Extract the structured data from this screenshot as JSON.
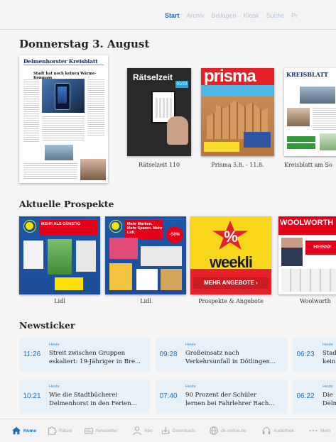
{
  "topnav": {
    "tabs": [
      "Start",
      "Archiv",
      "Beilagen",
      "Kiosk",
      "Suche",
      "Pr"
    ],
    "active": 0
  },
  "date_title": "Donnerstag 3. August",
  "issues": {
    "main_paper": {
      "masthead": "Delmenhorster Kreisblatt",
      "headline": "Stadt hat noch keinen Wärme-Kompass"
    },
    "items": [
      {
        "caption": "Rätselzeit 110",
        "cover_title": "Rätselzeit",
        "badge": "01/23"
      },
      {
        "caption": "Prisma 5.8. - 11.8.",
        "cover_title": "prisma"
      },
      {
        "caption": "Kreisblatt am So",
        "cover_title": "KREISBLATT"
      }
    ]
  },
  "prospekte": {
    "title": "Aktuelle Prospekte",
    "items": [
      {
        "caption": "Lidl",
        "banner": "MEHR ALS GÜNSTIG"
      },
      {
        "caption": "Lidl",
        "banner": "Mehr Marken. Mehr Sparen. Mehr Lidl.",
        "sale": "-50%"
      },
      {
        "caption": "Prospekte & Angebote",
        "pct": "%",
        "brand": "weekli",
        "button": "MEHR ANGEBOTE ›"
      },
      {
        "caption": "Woolworth",
        "brand": "WOOLWORTH",
        "hot": "HEISSE PREISE"
      }
    ]
  },
  "newsticker": {
    "title": "Newsticker",
    "items": [
      {
        "time": "11:26",
        "label": "Heute",
        "line1": "Streit zwischen Gruppen",
        "line2": "eskaliert: 19-Jähriger in Bre..."
      },
      {
        "time": "09:28",
        "label": "Heute",
        "line1": "Großeinsatz nach",
        "line2": "Verkehrsunfall in Dötlingen..."
      },
      {
        "time": "06:23",
        "label": "Heute",
        "line1": "Stad",
        "line2": "kein"
      },
      {
        "time": "10:21",
        "label": "Heute",
        "line1": "Wie die Stadtbücherei",
        "line2": "Delmenhorst in den Ferien..."
      },
      {
        "time": "07:40",
        "label": "Heute",
        "line1": "90 Prozent der Schüler",
        "line2": "lernen bei Fahrlehrer Rach..."
      },
      {
        "time": "06:22",
        "label": "Heute",
        "line1": "Die",
        "line2": "Delm"
      }
    ]
  },
  "bottombar": {
    "items": [
      {
        "label": "Home",
        "icon": "home-icon",
        "active": true
      },
      {
        "label": "Rätsel",
        "icon": "puzzle-icon"
      },
      {
        "label": "Newsletter",
        "icon": "newsletter-icon"
      },
      {
        "label": "Abo",
        "icon": "person-icon"
      },
      {
        "label": "Downloads",
        "icon": "download-icon"
      },
      {
        "label": "dk-online.de",
        "icon": "globe-icon"
      },
      {
        "label": "Audiothek",
        "icon": "headphones-icon"
      },
      {
        "label": "Mehr",
        "icon": "more-icon"
      }
    ]
  },
  "colors": {
    "accent": "#1f6fb5",
    "ticker_bg": "#e8f1f8"
  }
}
